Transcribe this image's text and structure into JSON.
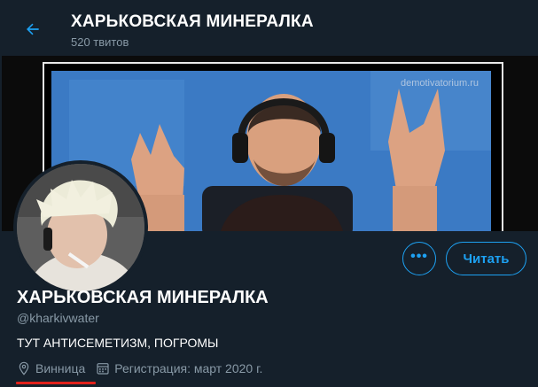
{
  "header": {
    "back_icon": "arrow-left-icon",
    "title": "ХАРЬКОВСКАЯ МИНЕРАЛКА",
    "tweet_count": "520 твитов"
  },
  "banner": {
    "watermark": "demotivatorium.ru"
  },
  "profile": {
    "more_label": "•••",
    "follow_label": "Читать",
    "display_name": "ХАРЬКОВСКАЯ МИНЕРАЛКА",
    "handle": "@kharkivwater",
    "bio": "ТУТ АНТИСЕМЕТИЗМ, ПОГРОМЫ",
    "location": "Винница",
    "location_icon": "location-pin-icon",
    "joined": "Регистрация: март 2020 г.",
    "joined_icon": "calendar-icon"
  },
  "colors": {
    "background": "#15202b",
    "accent": "#1da1f2",
    "secondary_text": "#8899a6",
    "highlight_underline": "#e0201a"
  }
}
